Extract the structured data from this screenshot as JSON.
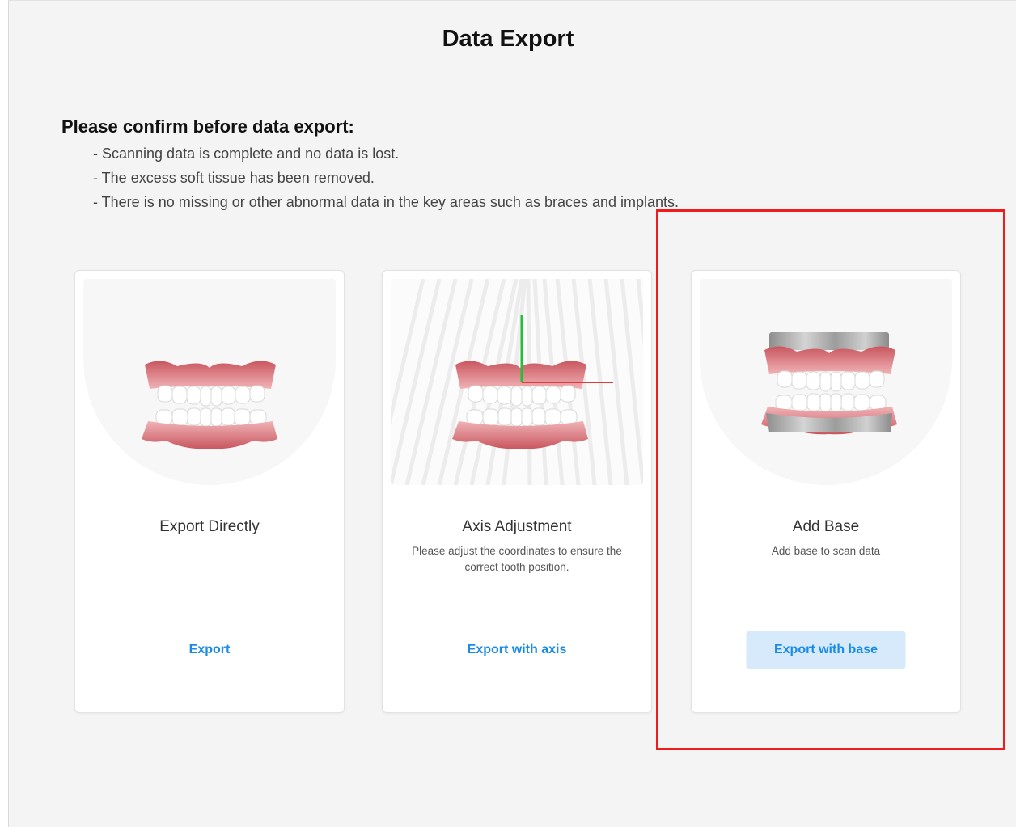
{
  "page": {
    "title": "Data Export"
  },
  "confirm": {
    "heading": "Please confirm before data export:",
    "items": [
      "- Scanning data is complete and no data is lost.",
      "- The excess soft tissue has been removed.",
      "- There is no missing or other abnormal data in the key areas such as braces and implants."
    ]
  },
  "cards": [
    {
      "title": "Export Directly",
      "description": "",
      "action": "Export",
      "illustration": "teeth-model-icon"
    },
    {
      "title": "Axis Adjustment",
      "description": "Please adjust the coordinates to ensure the correct tooth position.",
      "action": "Export with axis",
      "illustration": "teeth-with-axis-icon"
    },
    {
      "title": "Add Base",
      "description": "Add base to scan data",
      "action": "Export with base",
      "illustration": "teeth-with-base-icon"
    }
  ],
  "colors": {
    "accent": "#1a8ce8",
    "button_highlight": "#d6eafb",
    "annotation_frame": "#ee1c1c",
    "gum": "#d8767c",
    "axis_green": "#22c03a",
    "axis_red": "#e23b3b"
  }
}
